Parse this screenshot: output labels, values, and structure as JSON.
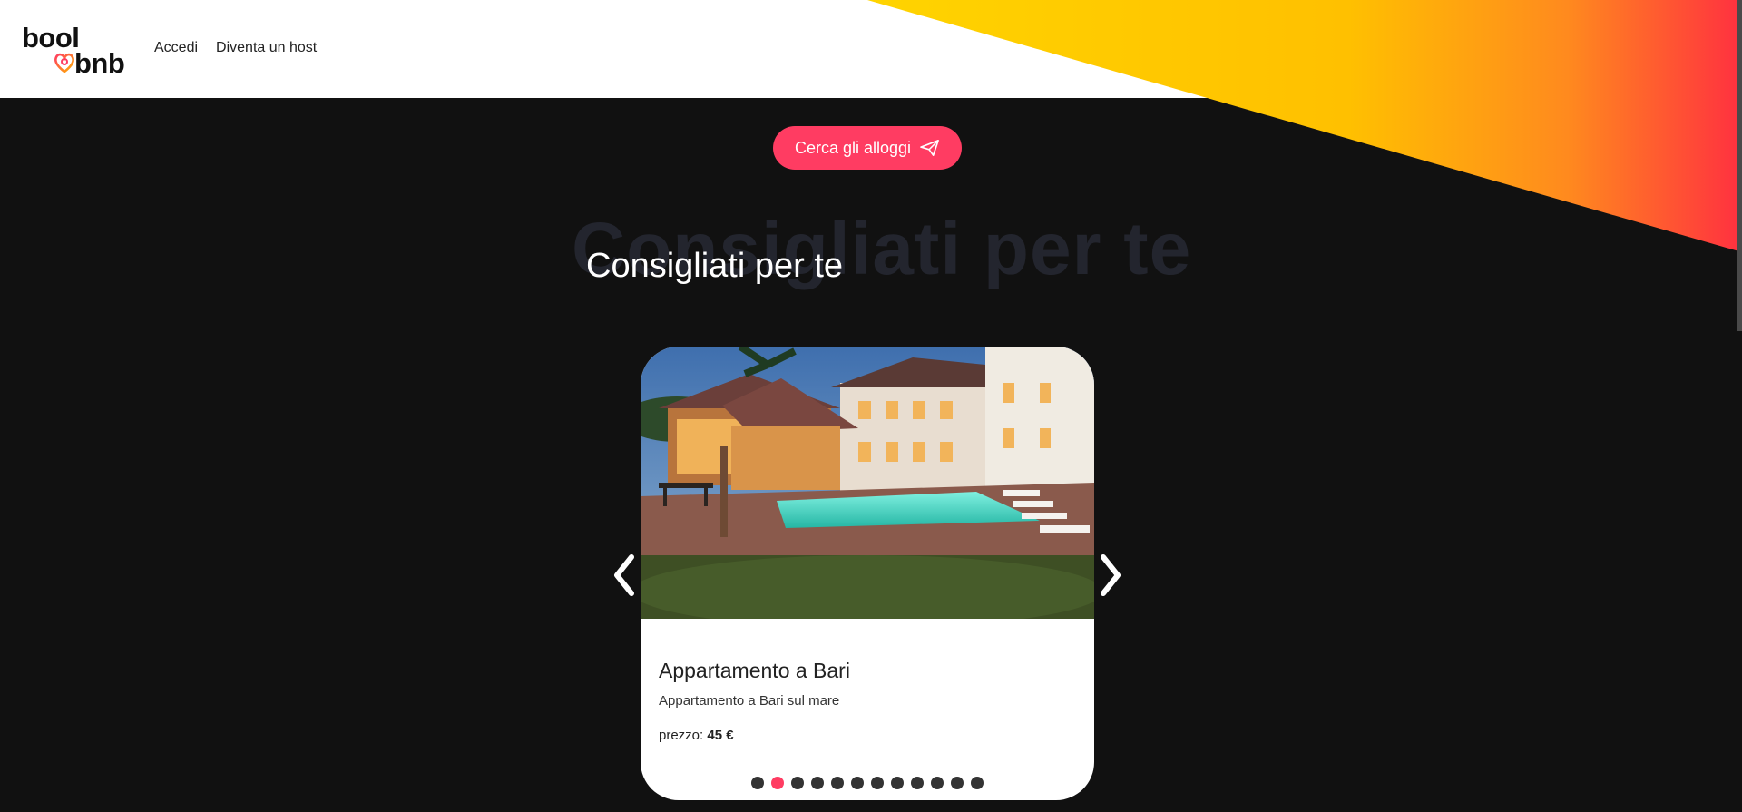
{
  "header": {
    "logo_top": "bool",
    "logo_bottom": "bnb",
    "nav": [
      {
        "label": "Accedi"
      },
      {
        "label": "Diventa un host"
      }
    ]
  },
  "search": {
    "button_label": "Cerca gli alloggi",
    "icon": "paper-plane-icon"
  },
  "section": {
    "title": "Consigliati per te",
    "title_shadow": "Consigliati per te"
  },
  "carousel": {
    "active_index": 1,
    "total": 12,
    "card": {
      "title": "Appartamento a Bari",
      "description": "Appartamento a Bari sul mare",
      "price_label": "prezzo:",
      "price_value": "45 €"
    }
  },
  "colors": {
    "accent": "#ff3c62",
    "gradient_start": "#ffd400",
    "gradient_end": "#ff3040",
    "background": "#111111"
  }
}
